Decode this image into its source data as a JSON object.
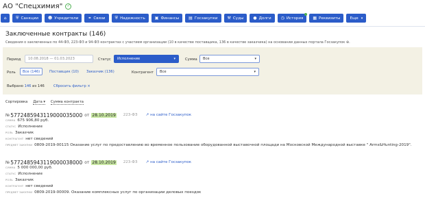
{
  "header": {
    "title": "АО \"Спецхимия\""
  },
  "nav": {
    "home_icon": "home-icon",
    "buttons": [
      {
        "label": "Санкции",
        "icon": "shield-icon"
      },
      {
        "label": "Учредители",
        "icon": "users-icon"
      },
      {
        "label": "Связи",
        "icon": "link-icon"
      },
      {
        "label": "Надежность",
        "icon": "check-shield-icon"
      },
      {
        "label": "Финансы",
        "icon": "briefcase-icon"
      },
      {
        "label": "Госзакупки",
        "icon": "cart-icon"
      },
      {
        "label": "Суды",
        "icon": "gavel-icon"
      },
      {
        "label": "Долги",
        "icon": "coins-icon"
      },
      {
        "label": "История",
        "icon": "clock-icon"
      },
      {
        "label": "Реквизиты",
        "icon": "document-icon"
      },
      {
        "label": "Еще",
        "icon": "chevron-down-icon"
      }
    ]
  },
  "section": {
    "title": "Заключенные контракты (146)",
    "description": "Сведения о заключенных по 44-ФЗ, 223-ФЗ и 94-ФЗ контрактах с участием организации (10 в качестве поставщика, 136 в качестве заказчика) на основании данных портала Госзакупок ⊕."
  },
  "filters": {
    "period_label": "Период",
    "period_value": "10.08.2018 — 01.03.2023",
    "status_label": "Статус",
    "status_value": "Исполнение",
    "sum_label": "Сумма",
    "sum_value": "Все",
    "role_label": "Роль",
    "roles": [
      "Все (146)",
      "Поставщик (10)",
      "Заказчик (136)"
    ],
    "counterparty_label": "Контрагент",
    "counterparty_value": "Все",
    "selected_prefix": "Выбрано",
    "selected_count": "146",
    "selected_suffix": "из 146",
    "reset_label": "Сбросить фильтр ×"
  },
  "sort": {
    "label": "Сортировка",
    "by_date": "Дата ▾",
    "by_sum": "Сумма контракта"
  },
  "contracts": [
    {
      "no_prefix": "№",
      "number": "5772485943119000035000",
      "ot": "от",
      "date": "28.10.2019",
      "law": "223-ФЗ",
      "link": "на сайте Госзакупок",
      "sum_label": "сумма",
      "sum": "675 906,80 руб.",
      "status_label": "статус",
      "status": "Исполнение",
      "role_label": "роль",
      "role": "Заказчик",
      "counterparty_label": "контрагент",
      "counterparty": "нет сведений",
      "subject_label": "предмет закупки",
      "subject": "0809-2019-00115 Оказание услуг по предоставлению во временное пользование оборудованной выставочной площади на Московской Международной выставке \" Arms&Hunting-2019\"."
    },
    {
      "no_prefix": "№",
      "number": "5772485943119000038000",
      "ot": "от",
      "date": "28.10.2019",
      "law": "223-ФЗ",
      "link": "на сайте Госзакупок",
      "sum_label": "сумма",
      "sum": "5 000 000,00 руб.",
      "status_label": "статус",
      "status": "Исполнение",
      "role_label": "роль",
      "role": "Заказчик",
      "counterparty_label": "контрагент",
      "counterparty": "нет сведений",
      "subject_label": "предмет закупки",
      "subject": "0809-2019-00009. Оказание комплексных услуг по организации деловых поездок"
    }
  ],
  "colors": {
    "accent": "#2b5cc9",
    "filter_bg": "#f3f1e4",
    "date_highlight": "#c7e6a1",
    "online_dot": "#4caf50"
  }
}
